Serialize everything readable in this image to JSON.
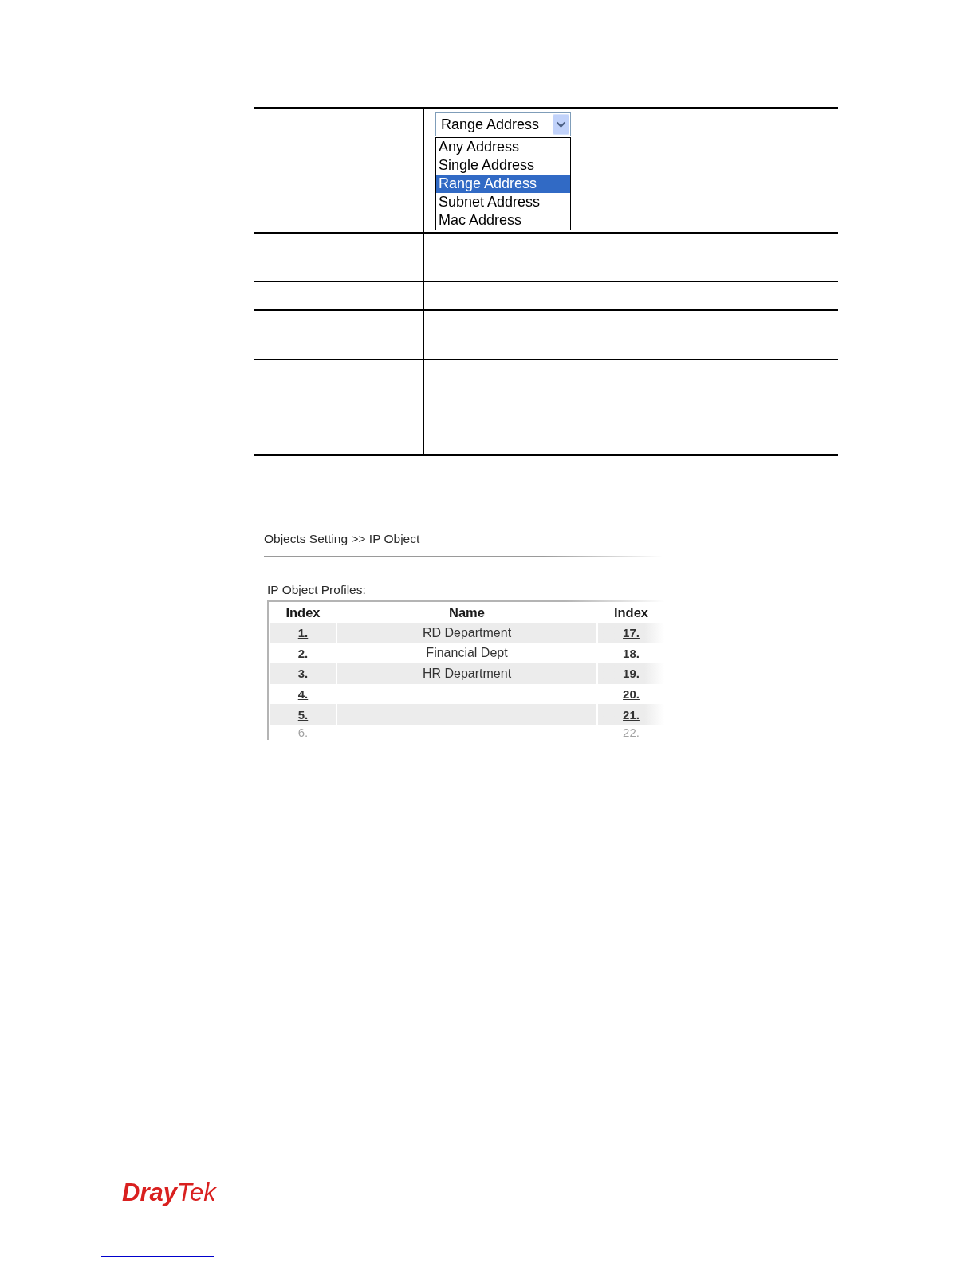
{
  "address_select": {
    "value": "Range Address",
    "expanded": true,
    "options": [
      {
        "label": "Any Address",
        "selected": false
      },
      {
        "label": "Single Address",
        "selected": false
      },
      {
        "label": "Range Address",
        "selected": true
      },
      {
        "label": "Subnet Address",
        "selected": false
      },
      {
        "label": "Mac Address",
        "selected": false
      }
    ]
  },
  "ip_object_screenshot": {
    "breadcrumb": "Objects Setting >> IP Object",
    "section_title": "IP Object Profiles:",
    "table": {
      "columns": [
        "Index",
        "Name",
        "Index"
      ],
      "rows": [
        {
          "index": "1.",
          "name": "RD Department",
          "index_2": "17.",
          "faded": false
        },
        {
          "index": "2.",
          "name": "Financial Dept",
          "index_2": "18.",
          "faded": false
        },
        {
          "index": "3.",
          "name": "HR Department",
          "index_2": "19.",
          "faded": false
        },
        {
          "index": "4.",
          "index_2": "20.",
          "faded": false
        },
        {
          "index": "5.",
          "index_2": "21.",
          "faded": false
        },
        {
          "index": "6.",
          "index_2": "22.",
          "faded": true
        }
      ]
    }
  },
  "logo": {
    "text": "**Dray**Tek"
  }
}
